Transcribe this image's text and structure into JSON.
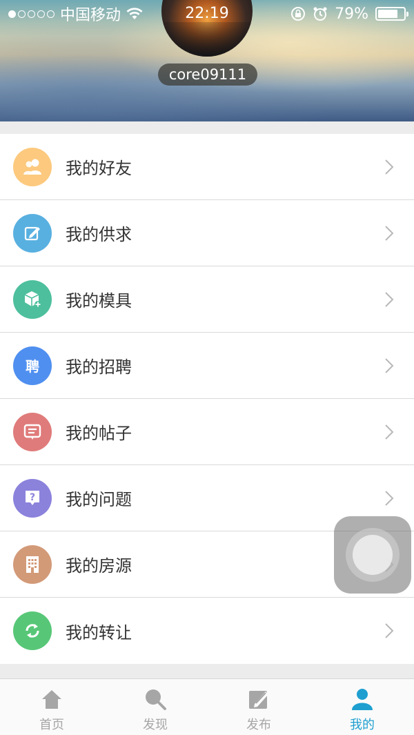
{
  "status_bar": {
    "carrier": "中国移动",
    "time": "22:19",
    "battery": "79%",
    "battery_level": 0.79
  },
  "profile": {
    "username": "core09111"
  },
  "menu": {
    "items": [
      {
        "label": "我的好友",
        "icon": "friends-icon",
        "color": "#fcc97e"
      },
      {
        "label": "我的供求",
        "icon": "edit-icon",
        "color": "#58b0e0"
      },
      {
        "label": "我的模具",
        "icon": "cube-add-icon",
        "color": "#4dbf9c"
      },
      {
        "label": "我的招聘",
        "icon": "recruit-icon",
        "icon_text": "聘",
        "color": "#4f8ff0"
      },
      {
        "label": "我的帖子",
        "icon": "post-icon",
        "color": "#e07b7b"
      },
      {
        "label": "我的问题",
        "icon": "question-icon",
        "icon_text": "?",
        "color": "#8b82dc"
      },
      {
        "label": "我的房源",
        "icon": "building-icon",
        "color": "#d39a78"
      },
      {
        "label": "我的转让",
        "icon": "transfer-icon",
        "color": "#57c777"
      }
    ]
  },
  "tabbar": {
    "tabs": [
      {
        "label": "首页",
        "icon": "home-icon"
      },
      {
        "label": "发现",
        "icon": "search-icon"
      },
      {
        "label": "发布",
        "icon": "publish-icon"
      },
      {
        "label": "我的",
        "icon": "user-icon",
        "active": true
      }
    ],
    "active_color": "#1e9fd0",
    "inactive_color": "#a6a6a6"
  }
}
